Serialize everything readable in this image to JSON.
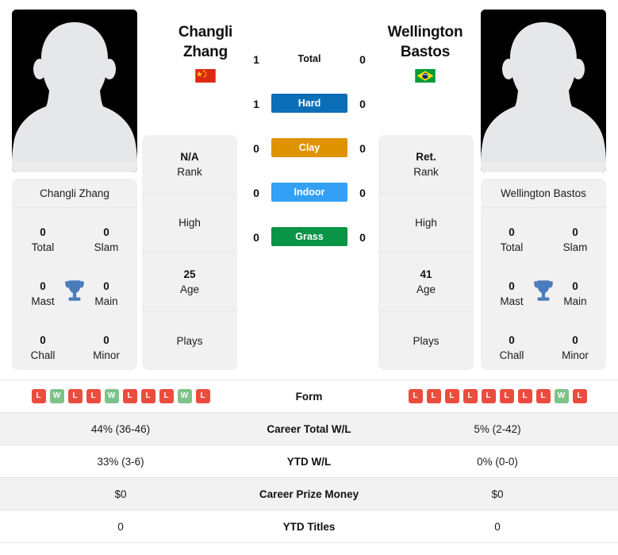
{
  "colors": {
    "hard": "#0d6eb8",
    "clay": "#e09300",
    "indoor": "#34a0f5",
    "grass": "#0a9445",
    "win": "#7dc389",
    "loss": "#ec4c3e",
    "trophy": "#4a7cbd",
    "card_bg": "#f1f1f1",
    "row_shaded": "#f2f2f2"
  },
  "players": {
    "left": {
      "first_name": "Changli",
      "last_name": "Zhang",
      "full_name": "Changli Zhang",
      "flag": "cn-flag",
      "rank": "N/A",
      "rank_label": "Rank",
      "high_label": "High",
      "age": "25",
      "age_label": "Age",
      "plays_label": "Plays",
      "titles": [
        {
          "value": "0",
          "label": "Total"
        },
        {
          "value": "0",
          "label": "Slam"
        },
        {
          "value": "0",
          "label": "Mast"
        },
        {
          "value": "0",
          "label": "Main"
        },
        {
          "value": "0",
          "label": "Chall"
        },
        {
          "value": "0",
          "label": "Minor"
        }
      ],
      "form": [
        "L",
        "W",
        "L",
        "L",
        "W",
        "L",
        "L",
        "L",
        "W",
        "L"
      ],
      "career_total_wl": "44% (36-46)",
      "ytd_wl": "33% (3-6)",
      "career_prize_money": "$0",
      "ytd_titles": "0"
    },
    "right": {
      "first_name": "Wellington",
      "last_name": "Bastos",
      "full_name": "Wellington Bastos",
      "flag": "br-flag",
      "rank": "Ret.",
      "rank_label": "Rank",
      "high_label": "High",
      "age": "41",
      "age_label": "Age",
      "plays_label": "Plays",
      "titles": [
        {
          "value": "0",
          "label": "Total"
        },
        {
          "value": "0",
          "label": "Slam"
        },
        {
          "value": "0",
          "label": "Mast"
        },
        {
          "value": "0",
          "label": "Main"
        },
        {
          "value": "0",
          "label": "Chall"
        },
        {
          "value": "0",
          "label": "Minor"
        }
      ],
      "form": [
        "L",
        "L",
        "L",
        "L",
        "L",
        "L",
        "L",
        "L",
        "W",
        "L"
      ],
      "career_total_wl": "5% (2-42)",
      "ytd_wl": "0% (0-0)",
      "career_prize_money": "$0",
      "ytd_titles": "0"
    }
  },
  "h2h": [
    {
      "surface": "Total",
      "left": "1",
      "right": "0",
      "pill": false,
      "color": ""
    },
    {
      "surface": "Hard",
      "left": "1",
      "right": "0",
      "pill": true,
      "color": "#0d6eb8"
    },
    {
      "surface": "Clay",
      "left": "0",
      "right": "0",
      "pill": true,
      "color": "#e09300"
    },
    {
      "surface": "Indoor",
      "left": "0",
      "right": "0",
      "pill": true,
      "color": "#34a0f5"
    },
    {
      "surface": "Grass",
      "left": "0",
      "right": "0",
      "pill": true,
      "color": "#0a9445"
    }
  ],
  "table": {
    "rows": [
      {
        "label": "Form",
        "type": "form",
        "shaded": false
      },
      {
        "label": "Career Total W/L",
        "type": "text",
        "shaded": true,
        "key": "career_total_wl"
      },
      {
        "label": "YTD W/L",
        "type": "text",
        "shaded": false,
        "key": "ytd_wl"
      },
      {
        "label": "Career Prize Money",
        "type": "text",
        "shaded": true,
        "key": "career_prize_money"
      },
      {
        "label": "YTD Titles",
        "type": "text",
        "shaded": false,
        "key": "ytd_titles"
      }
    ]
  }
}
